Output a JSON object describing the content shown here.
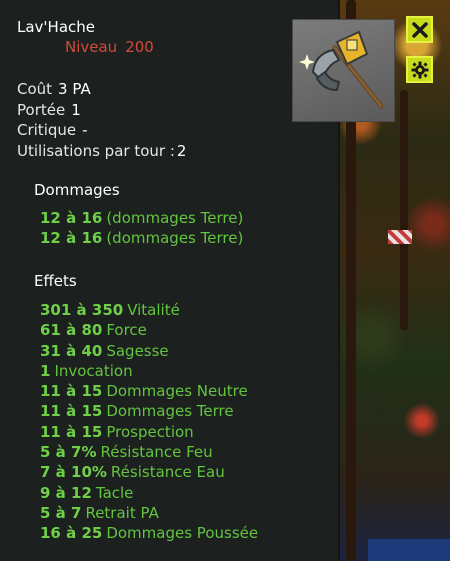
{
  "item": {
    "name": "Lav'Hache",
    "level_label": "Niveau",
    "level_value": "200",
    "icon": "axe-item-icon"
  },
  "stats": [
    {
      "label": "Coût",
      "value": "3 PA"
    },
    {
      "label": "Portée",
      "value": "1"
    },
    {
      "label": "Critique",
      "value": "-"
    },
    {
      "label": "Utilisations par tour :",
      "value": "2"
    }
  ],
  "damage": {
    "heading": "Dommages",
    "lines": [
      {
        "value": "12 à 16",
        "text": "(dommages Terre)"
      },
      {
        "value": "12 à 16",
        "text": "(dommages Terre)"
      }
    ]
  },
  "effects": {
    "heading": "Effets",
    "lines": [
      {
        "value": "301 à 350",
        "text": "Vitalité"
      },
      {
        "value": "61 à 80",
        "text": "Force"
      },
      {
        "value": "31 à 40",
        "text": "Sagesse"
      },
      {
        "value": "1",
        "text": "Invocation"
      },
      {
        "value": "11 à 15",
        "text": "Dommages Neutre"
      },
      {
        "value": "11 à 15",
        "text": "Dommages Terre"
      },
      {
        "value": "11 à 15",
        "text": "Prospection"
      },
      {
        "value": "5 à 7%",
        "text": "Résistance Feu"
      },
      {
        "value": "7 à 10%",
        "text": "Résistance Eau"
      },
      {
        "value": "9 à 12",
        "text": "Tacle"
      },
      {
        "value": "5 à 7",
        "text": "Retrait PA"
      },
      {
        "value": "16 à 25",
        "text": "Dommages Poussée"
      }
    ]
  },
  "buttons": {
    "close_icon": "close-icon",
    "settings_icon": "gear-icon"
  },
  "colors": {
    "panel_bg": "#1c211f",
    "level_red": "#d24b3a",
    "effect_green": "#63c43f",
    "button_yellow": "#c9dc1b"
  }
}
